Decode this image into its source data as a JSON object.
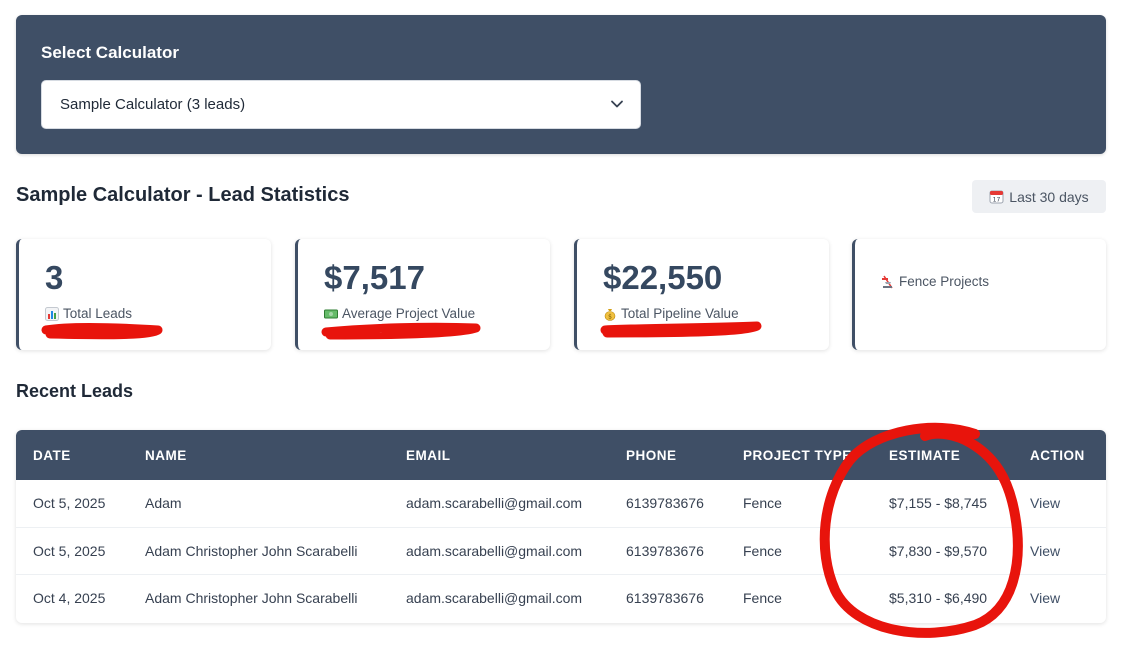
{
  "selector": {
    "label": "Select Calculator",
    "selected_value": "Sample Calculator (3 leads)"
  },
  "stats": {
    "title": "Sample Calculator - Lead Statistics",
    "date_range": "Last 30 days",
    "cards": [
      {
        "value": "3",
        "label": "Total Leads",
        "icon": "bar-chart-icon"
      },
      {
        "value": "$7,517",
        "label": "Average Project Value",
        "icon": "dollar-bill-icon"
      },
      {
        "value": "$22,550",
        "label": "Total Pipeline Value",
        "icon": "money-bag-icon"
      },
      {
        "value": "",
        "label": "Fence Projects",
        "icon": "construction-icon"
      }
    ]
  },
  "leads": {
    "title": "Recent Leads",
    "columns": [
      "DATE",
      "NAME",
      "EMAIL",
      "PHONE",
      "PROJECT TYPE",
      "ESTIMATE",
      "ACTION"
    ],
    "rows": [
      {
        "date": "Oct 5, 2025",
        "name": "Adam",
        "email": "adam.scarabelli@gmail.com",
        "phone": "6139783676",
        "project_type": "Fence",
        "estimate": "$7,155 - $8,745",
        "action": "View"
      },
      {
        "date": "Oct 5, 2025",
        "name": "Adam Christopher John Scarabelli",
        "email": "adam.scarabelli@gmail.com",
        "phone": "6139783676",
        "project_type": "Fence",
        "estimate": "$7,830 - $9,570",
        "action": "View"
      },
      {
        "date": "Oct 4, 2025",
        "name": "Adam Christopher John Scarabelli",
        "email": "adam.scarabelli@gmail.com",
        "phone": "6139783676",
        "project_type": "Fence",
        "estimate": "$5,310 - $6,490",
        "action": "View"
      }
    ]
  },
  "colors": {
    "header_bg": "#3f4f66",
    "annotation_red": "#e8140c"
  }
}
